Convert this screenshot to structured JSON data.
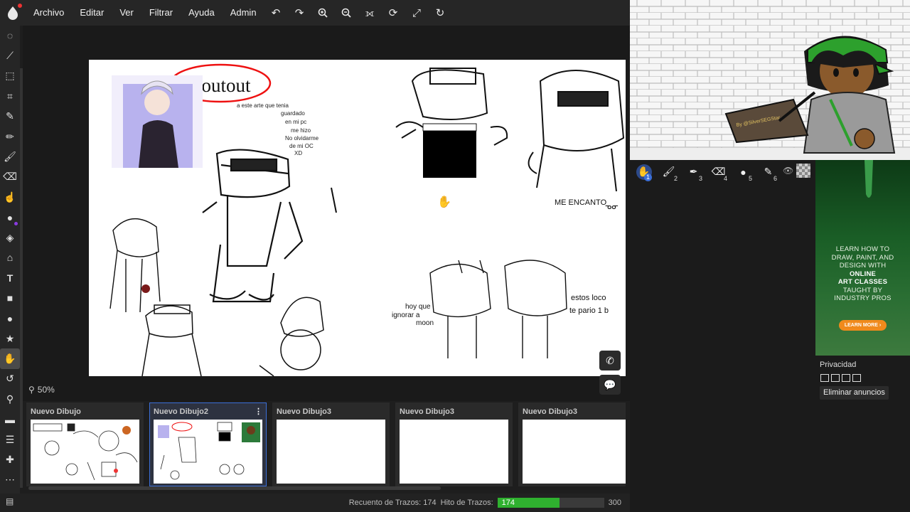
{
  "menu": {
    "items": [
      "Archivo",
      "Editar",
      "Ver",
      "Filtrar",
      "Ayuda",
      "Admin"
    ],
    "toolbar_icons": [
      "undo-icon",
      "redo-icon",
      "zoom-in-icon",
      "zoom-out-icon",
      "flip-icon",
      "rotate-icon",
      "fullscreen-icon",
      "reset-rotation-icon"
    ]
  },
  "left_tools": [
    "lasso-select-icon",
    "free-select-icon",
    "transform-icon",
    "crop-icon",
    "eyedropper-icon",
    "pencil-icon",
    "brush-icon",
    "eraser-icon",
    "smudge-icon",
    "blob-icon",
    "fill-icon",
    "stamp-icon",
    "text-icon",
    "rectangle-icon",
    "ellipse-icon",
    "star-icon",
    "hand-icon",
    "undo-tool-icon",
    "search-tool-icon",
    "chat-tool-icon",
    "layers-tool-icon",
    "plus-tool-icon",
    "more-icon"
  ],
  "canvas": {
    "zoom": "50%",
    "drawing_texts": {
      "shoutout": "Shoutout",
      "note": "a este arte que tenia guardado en mi pc me hizo No olvidarme de mi OC XD",
      "me_encanto": "ME ENCANTO",
      "hoy_que": "hoy que ignorar a moon",
      "estos": "estos loco te pario 1 b"
    }
  },
  "frames": [
    {
      "title": "Nuevo Dibujo",
      "selected": false
    },
    {
      "title": "Nuevo Dibujo2",
      "selected": true
    },
    {
      "title": "Nuevo Dibujo3",
      "selected": false
    },
    {
      "title": "Nuevo Dibujo3",
      "selected": false
    },
    {
      "title": "Nuevo Dibujo3",
      "selected": false
    }
  ],
  "status": {
    "stroke_count_label": "Recuento de Trazos: 174",
    "stroke_limit_label": "Hito de Trazos:",
    "stroke_value": "174",
    "stroke_max": "300",
    "stroke_fraction": 0.58
  },
  "brushes": [
    {
      "icon": "hand-icon",
      "num": "1",
      "active": true
    },
    {
      "icon": "brush-icon",
      "num": "2"
    },
    {
      "icon": "pen-icon",
      "num": "3"
    },
    {
      "icon": "eraser-icon",
      "num": "4"
    },
    {
      "icon": "dot-brush-icon",
      "num": "5"
    },
    {
      "icon": "fine-brush-icon",
      "num": "6"
    }
  ],
  "ad": {
    "line1": "LEARN HOW TO",
    "line2": "DRAW, PAINT, AND",
    "line3": "DESIGN WITH",
    "line4": "ONLINE",
    "line5": "ART CLASSES",
    "line6": "TAUGHT BY",
    "line7": "INDUSTRY PROS",
    "button": "LEARN MORE ›"
  },
  "panel": {
    "privacy": "Privacidad",
    "remove_ads": "Eliminar anuncios"
  },
  "accent": "#3b6fd8",
  "progress_color": "#2fb12f"
}
